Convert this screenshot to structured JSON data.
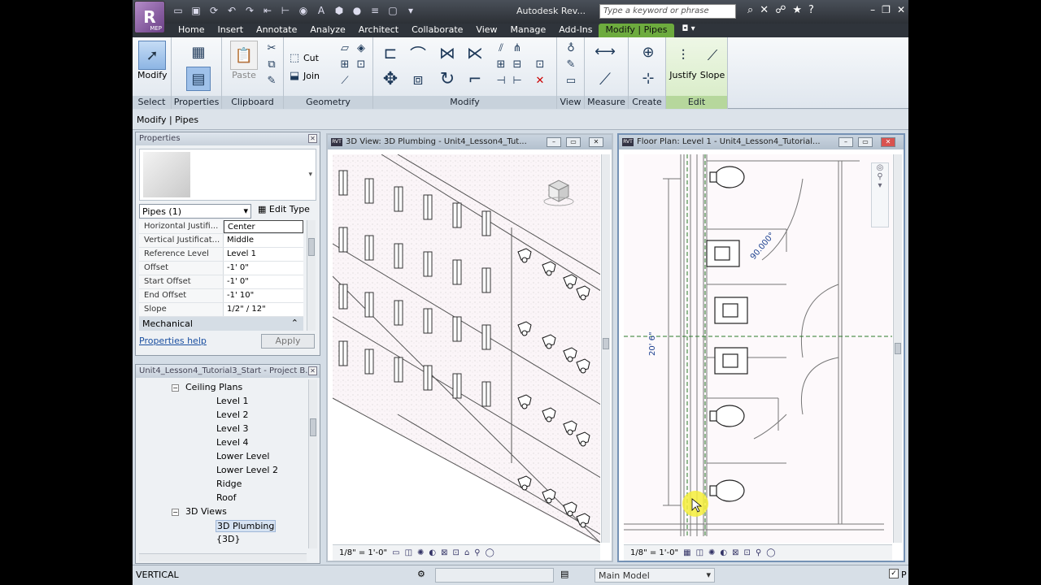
{
  "app": {
    "badge": "R",
    "badge_sub": "MEP",
    "title": "Autodesk Rev...",
    "search_placeholder": "Type a keyword or phrase"
  },
  "ribbon": {
    "tabs": [
      "Home",
      "Insert",
      "Annotate",
      "Analyze",
      "Architect",
      "Collaborate",
      "View",
      "Manage",
      "Add-Ins",
      "Modify | Pipes"
    ],
    "active_tab": "Modify | Pipes",
    "panels": {
      "select": "Select",
      "properties": "Properties",
      "clipboard": "Clipboard",
      "geometry": "Geometry",
      "modify": "Modify",
      "view": "View",
      "measure": "Measure",
      "create": "Create",
      "edit": "Edit"
    },
    "buttons": {
      "modify": "Modify",
      "paste": "Paste",
      "cut": "Cut",
      "join": "Join",
      "justify": "Justify",
      "slope": "Slope"
    }
  },
  "context_bar": "Modify | Pipes",
  "properties": {
    "title": "Properties",
    "type_selector": "Pipes (1)",
    "edit_type": "Edit Type",
    "rows": [
      {
        "key": "Horizontal Justifi...",
        "value": "Center"
      },
      {
        "key": "Vertical Justificat...",
        "value": "Middle"
      },
      {
        "key": "Reference Level",
        "value": "Level 1"
      },
      {
        "key": "Offset",
        "value": "-1'  0\""
      },
      {
        "key": "Start Offset",
        "value": "-1'  0\""
      },
      {
        "key": "End Offset",
        "value": "-1'  10\""
      },
      {
        "key": "Slope",
        "value": "1/2\" / 12\""
      }
    ],
    "category": "Mechanical",
    "help": "Properties help",
    "apply": "Apply"
  },
  "browser": {
    "title": "Unit4_Lesson4_Tutorial3_Start - Project B...",
    "items": [
      {
        "label": "Ceiling Plans",
        "level": 1,
        "toggle": "−"
      },
      {
        "label": "Level 1",
        "level": 2
      },
      {
        "label": "Level 2",
        "level": 2
      },
      {
        "label": "Level 3",
        "level": 2
      },
      {
        "label": "Level 4",
        "level": 2
      },
      {
        "label": "Lower Level",
        "level": 2
      },
      {
        "label": "Lower Level 2",
        "level": 2
      },
      {
        "label": "Ridge",
        "level": 2
      },
      {
        "label": "Roof",
        "level": 2
      },
      {
        "label": "3D Views",
        "level": 1,
        "toggle": "−"
      },
      {
        "label": "3D Plumbing",
        "level": 2,
        "selected": true
      },
      {
        "label": "{3D}",
        "level": 2
      }
    ]
  },
  "view3d": {
    "title": "3D View: 3D Plumbing - Unit4_Lesson4_Tut...",
    "scale": "1/8\" = 1'-0\""
  },
  "plan": {
    "title": "Floor Plan: Level 1 - Unit4_Lesson4_Tutorial...",
    "scale": "1/8\" = 1'-0\"",
    "dim_label": "20'  6\"",
    "angle_label": "90.000°"
  },
  "status": {
    "text": "VERTICAL",
    "model": "Main Model",
    "flag": "P"
  }
}
